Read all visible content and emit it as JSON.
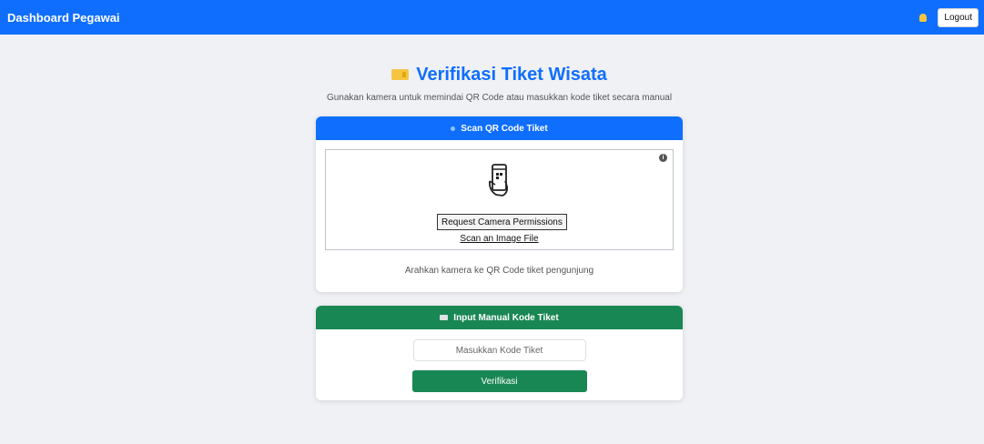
{
  "navbar": {
    "brand": "Dashboard Pegawai",
    "logout_label": "Logout",
    "notification_icon": "bell-icon"
  },
  "page": {
    "title": "Verifikasi Tiket Wisata",
    "title_icon": "ticket-icon",
    "subtitle": "Gunakan kamera untuk memindai QR Code atau masukkan kode tiket secara manual"
  },
  "scan_card": {
    "header": "Scan QR Code Tiket",
    "camera_permission_label": "Request Camera Permissions",
    "scan_file_label": "Scan an Image File",
    "hint": "Arahkan kamera ke QR Code tiket pengunjung",
    "info_glyph": "i"
  },
  "manual_card": {
    "header": "Input Manual Kode Tiket",
    "input_placeholder": "Masukkan Kode Tiket",
    "input_value": "",
    "verify_label": "Verifikasi"
  },
  "colors": {
    "primary": "#0f6efd",
    "success": "#198754",
    "background": "#f0f1f5",
    "accent_yellow": "#f5c542"
  }
}
